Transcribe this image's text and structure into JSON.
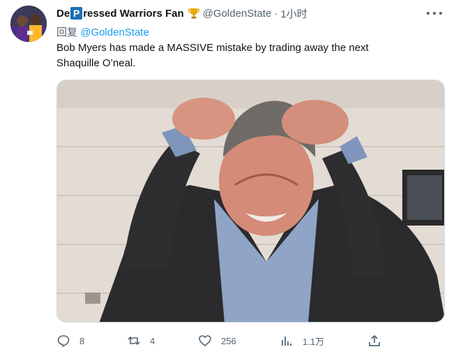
{
  "tweet": {
    "author": {
      "name_before": "De",
      "name_badge": "P",
      "name_after": "ressed Warriors Fan",
      "handle": "@GoldenState",
      "separator": "·",
      "time": "1小时"
    },
    "reply": {
      "prefix": "回复",
      "handle": "@GoldenState"
    },
    "text_line1": "Bob Myers has made a MASSIVE mistake by trading away the next",
    "text_line2": "Shaquille O’neal.",
    "media_description_icon": "image",
    "actions": {
      "reply_count": "8",
      "retweet_count": "4",
      "like_count": "256",
      "views_count": "1.1万"
    }
  },
  "colors": {
    "accent": "#1d9bf0",
    "muted": "#536471",
    "badge": "#1d6fb8"
  }
}
